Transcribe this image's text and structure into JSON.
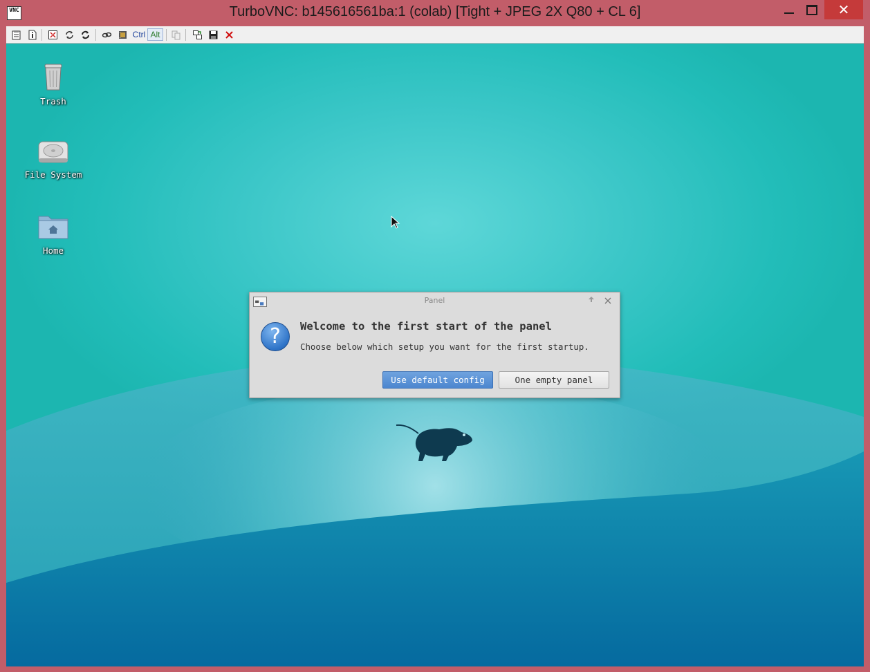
{
  "window": {
    "title": "TurboVNC: b145616561ba:1 (colab) [Tight + JPEG 2X Q80 + CL 6]",
    "app_icon_text": "VNC",
    "close_glyph": "✕"
  },
  "toolbar": {
    "ctrl_label": "Ctrl",
    "alt_label": "Alt"
  },
  "desktop": {
    "icons": [
      {
        "label": "Trash",
        "icon": "trash-icon"
      },
      {
        "label": "File System",
        "icon": "hard-drive-icon"
      },
      {
        "label": "Home",
        "icon": "home-folder-icon"
      }
    ]
  },
  "dialog": {
    "title": "Panel",
    "heading": "Welcome to the first start of the panel",
    "message": "Choose below which setup you want for the first startup.",
    "buttons": {
      "default": "Use default config",
      "empty": "One empty panel"
    },
    "icon_glyph": "?"
  },
  "colors": {
    "window_frame": "#c25d69",
    "desktop_teal": "#1cb6b0",
    "desktop_blue": "#0a6ea2",
    "default_button": "#4c86cf"
  }
}
